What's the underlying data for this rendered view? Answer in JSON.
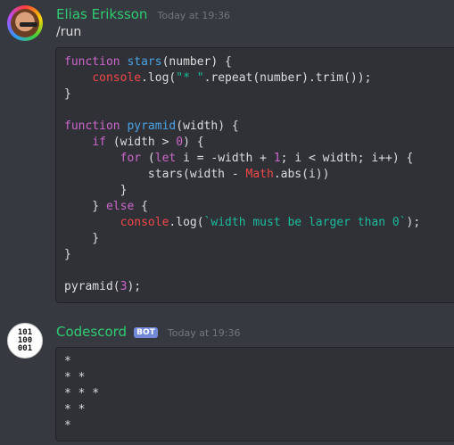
{
  "messages": [
    {
      "author": "Elias Eriksson",
      "timestamp": "Today at 19:36",
      "text": "/run",
      "code_lines": [
        [
          {
            "t": "kw",
            "v": "function "
          },
          {
            "t": "fn",
            "v": "stars"
          },
          {
            "t": "pl",
            "v": "(number) {"
          }
        ],
        [
          {
            "t": "pl",
            "v": "    "
          },
          {
            "t": "bi",
            "v": "console"
          },
          {
            "t": "pl",
            "v": ".log("
          },
          {
            "t": "str",
            "v": "\"* \""
          },
          {
            "t": "pl",
            "v": ".repeat(number).trim());"
          }
        ],
        [
          {
            "t": "pl",
            "v": "}"
          }
        ],
        [
          {
            "t": "pl",
            "v": ""
          }
        ],
        [
          {
            "t": "kw",
            "v": "function "
          },
          {
            "t": "fn",
            "v": "pyramid"
          },
          {
            "t": "pl",
            "v": "(width) {"
          }
        ],
        [
          {
            "t": "pl",
            "v": "    "
          },
          {
            "t": "kw",
            "v": "if"
          },
          {
            "t": "pl",
            "v": " (width > "
          },
          {
            "t": "num",
            "v": "0"
          },
          {
            "t": "pl",
            "v": ") {"
          }
        ],
        [
          {
            "t": "pl",
            "v": "        "
          },
          {
            "t": "kw",
            "v": "for"
          },
          {
            "t": "pl",
            "v": " ("
          },
          {
            "t": "kw",
            "v": "let"
          },
          {
            "t": "pl",
            "v": " i = -width + "
          },
          {
            "t": "num",
            "v": "1"
          },
          {
            "t": "pl",
            "v": "; i < width; i++) {"
          }
        ],
        [
          {
            "t": "pl",
            "v": "            stars(width - "
          },
          {
            "t": "bi",
            "v": "Math"
          },
          {
            "t": "pl",
            "v": ".abs(i))"
          }
        ],
        [
          {
            "t": "pl",
            "v": "        }"
          }
        ],
        [
          {
            "t": "pl",
            "v": "    } "
          },
          {
            "t": "kw",
            "v": "else"
          },
          {
            "t": "pl",
            "v": " {"
          }
        ],
        [
          {
            "t": "pl",
            "v": "        "
          },
          {
            "t": "bi",
            "v": "console"
          },
          {
            "t": "pl",
            "v": ".log("
          },
          {
            "t": "str",
            "v": "`width must be larger than 0`"
          },
          {
            "t": "pl",
            "v": ");"
          }
        ],
        [
          {
            "t": "pl",
            "v": "    }"
          }
        ],
        [
          {
            "t": "pl",
            "v": "}"
          }
        ],
        [
          {
            "t": "pl",
            "v": ""
          }
        ],
        [
          {
            "t": "pl",
            "v": "pyramid("
          },
          {
            "t": "num",
            "v": "3"
          },
          {
            "t": "pl",
            "v": ");"
          }
        ]
      ]
    },
    {
      "author": "Codescord",
      "bot_tag": "BOT",
      "timestamp": "Today at 19:36",
      "avatar_text": [
        "101",
        "100",
        "001"
      ],
      "output_lines": [
        "*",
        "* *",
        "* * *",
        "* *",
        "*"
      ]
    }
  ],
  "colors": {
    "background": "#36393f",
    "username": "#2ecc71",
    "bot_tag": "#7289da",
    "code_background": "#2f3136",
    "keyword": "#cc66cc",
    "function": "#4ba3e6",
    "builtin": "#f04747",
    "string": "#1abc9c"
  }
}
